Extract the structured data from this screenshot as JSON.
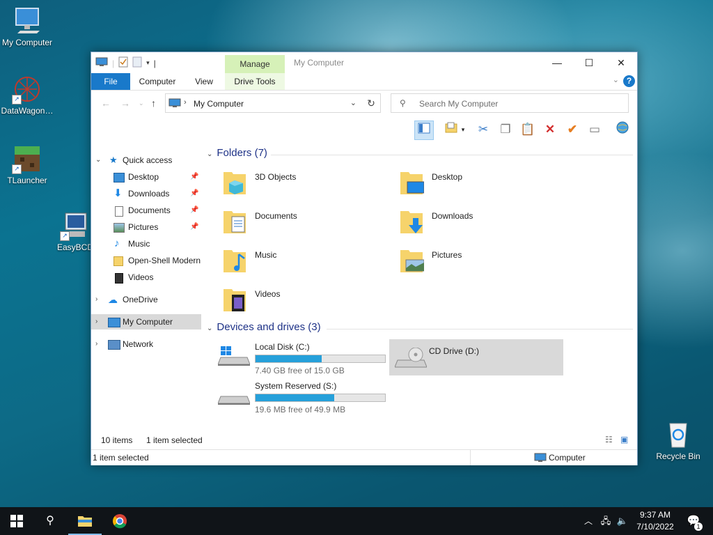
{
  "desktop": {
    "icons": [
      {
        "label": "My Computer"
      },
      {
        "label": "DataWagon…"
      },
      {
        "label": "TLauncher"
      },
      {
        "label": "EasyBCD"
      },
      {
        "label": "Recycle Bin"
      }
    ]
  },
  "window": {
    "title": "My Computer",
    "manage_tab": "Manage",
    "tabs": [
      "File",
      "Computer",
      "View",
      "Drive Tools"
    ],
    "address": "My Computer",
    "search_placeholder": "Search My Computer"
  },
  "nav": {
    "quick_access": "Quick access",
    "items": [
      "Desktop",
      "Downloads",
      "Documents",
      "Pictures",
      "Music",
      "Open-Shell Modern",
      "Videos"
    ],
    "onedrive": "OneDrive",
    "my_computer": "My Computer",
    "network": "Network"
  },
  "content": {
    "folders_header": "Folders (7)",
    "folders": [
      "3D Objects",
      "Desktop",
      "Documents",
      "Downloads",
      "Music",
      "Pictures",
      "Videos"
    ],
    "devices_header": "Devices and drives (3)",
    "drives": [
      {
        "name": "Local Disk (C:)",
        "free": "7.40 GB free of 15.0 GB",
        "used_fraction": 0.51
      },
      {
        "name": "CD Drive (D:)"
      },
      {
        "name": "System Reserved (S:)",
        "free": "19.6 MB free of 49.9 MB",
        "used_fraction": 0.61
      }
    ]
  },
  "status": {
    "items": "10 items",
    "selected": "1 item selected",
    "bottom_left": "1 item selected",
    "bottom_right": "Computer"
  },
  "taskbar": {
    "time": "9:37 AM",
    "date": "7/10/2022",
    "notif_count": "1"
  },
  "colors": {
    "accent": "#1979ca",
    "manage": "#d6f1b8",
    "bar": "#26a0da"
  }
}
